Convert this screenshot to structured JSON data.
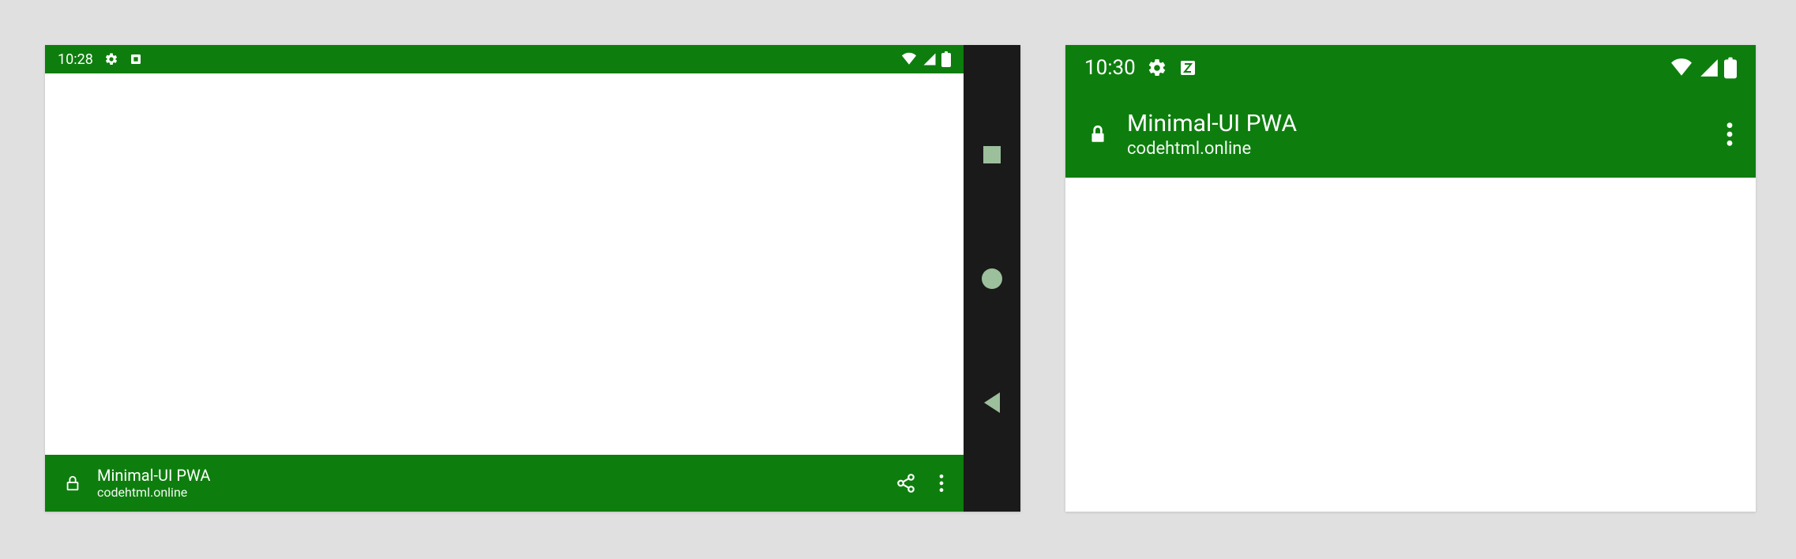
{
  "colors": {
    "brand": "#0d7e0d",
    "nav": "#1a1a1a",
    "navTint": "#9cbf9c"
  },
  "device1": {
    "statusbar": {
      "time": "10:28"
    },
    "appbar": {
      "title": "Minimal-UI PWA",
      "subtitle": "codehtml.online"
    }
  },
  "device2": {
    "statusbar": {
      "time": "10:30"
    },
    "appbar": {
      "title": "Minimal-UI PWA",
      "subtitle": "codehtml.online"
    }
  }
}
